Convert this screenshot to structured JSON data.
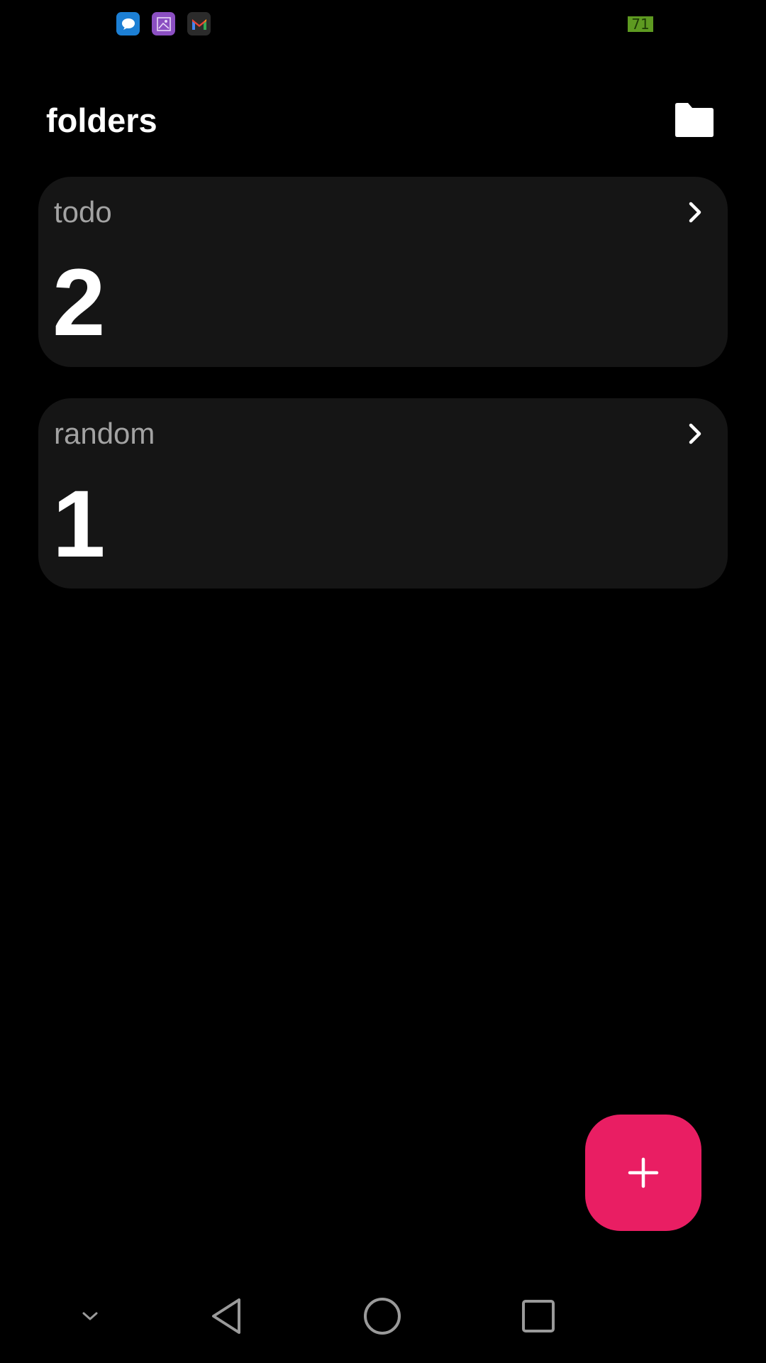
{
  "status_bar": {
    "notification_icons": [
      "messages-icon",
      "gallery-icon",
      "gmail-icon"
    ],
    "battery_level": "71"
  },
  "header": {
    "title": "folders",
    "folder_icon": "folder-icon"
  },
  "folders": [
    {
      "name": "todo",
      "count": "2"
    },
    {
      "name": "random",
      "count": "1"
    }
  ],
  "fab": {
    "icon": "plus-icon",
    "color": "#e91e63"
  },
  "nav_bar": {
    "buttons": [
      "collapse-icon",
      "back-icon",
      "home-icon",
      "recents-icon"
    ]
  },
  "colors": {
    "background": "#000000",
    "card": "#151515",
    "accent": "#e91e63",
    "folder_name": "#a3a3a3"
  }
}
